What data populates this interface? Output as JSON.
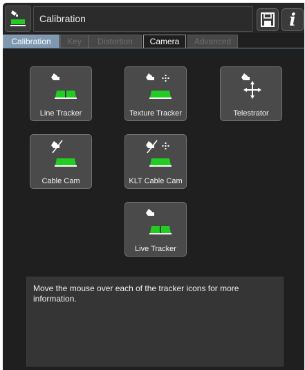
{
  "header": {
    "title": "Calibration",
    "app_icon": "camera-tracker-icon",
    "save_icon": "save-icon",
    "info_label": "i"
  },
  "tabs": [
    {
      "label": "Calibration",
      "state": "active"
    },
    {
      "label": "Key",
      "state": "disabled"
    },
    {
      "label": "Distortion",
      "state": "disabled"
    },
    {
      "label": "Camera",
      "state": "enabled"
    },
    {
      "label": "Advanced",
      "state": "disabled"
    }
  ],
  "trackers": [
    {
      "label": "Line Tracker",
      "icon": "line-tracker-icon"
    },
    {
      "label": "Texture Tracker",
      "icon": "texture-tracker-icon"
    },
    {
      "label": "Telestrator",
      "icon": "telestrator-icon"
    },
    {
      "label": "Cable Cam",
      "icon": "cable-cam-icon"
    },
    {
      "label": "KLT Cable Cam",
      "icon": "klt-cable-cam-icon"
    },
    {
      "label": "Live Tracker",
      "icon": "live-tracker-icon"
    }
  ],
  "info_text": "Move the mouse over each of the tracker icons for more information.",
  "colors": {
    "accent_green": "#22cc22",
    "active_tab": "#7e98b0",
    "background": "#1f1f1f",
    "tile": "#4a4a4a"
  }
}
